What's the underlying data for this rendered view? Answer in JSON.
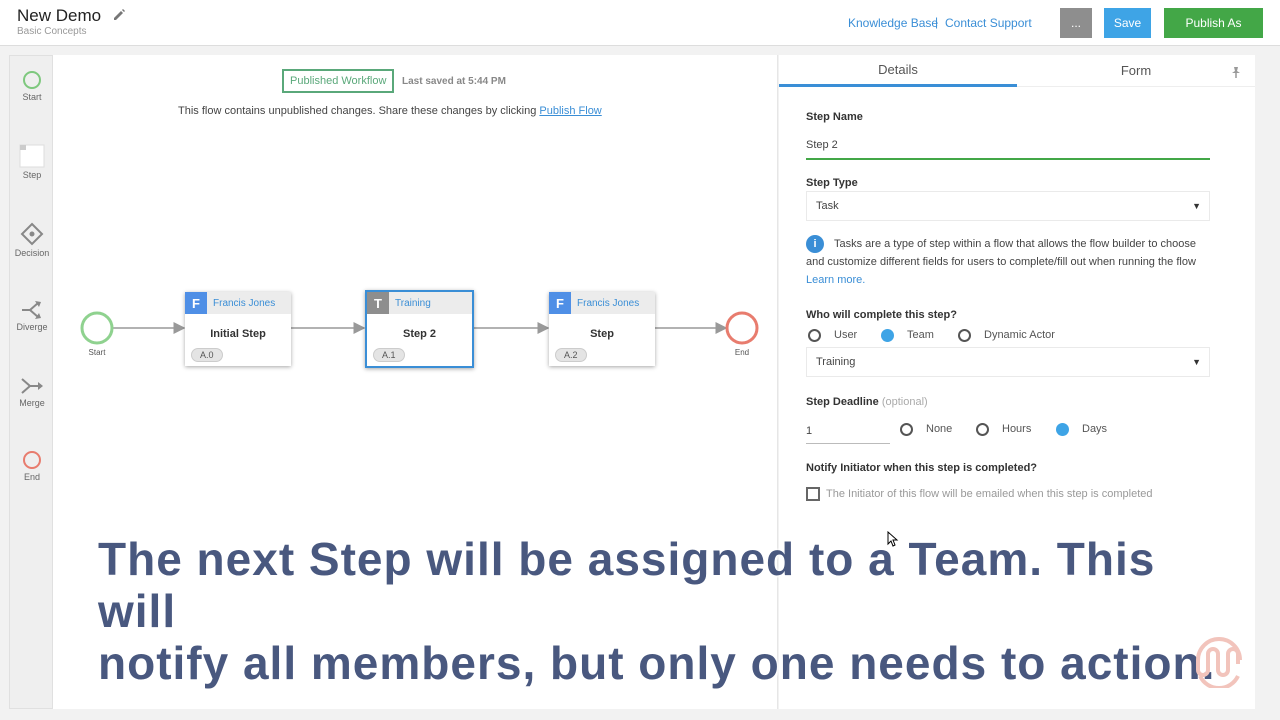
{
  "header": {
    "title": "New Demo",
    "subtitle": "Basic Concepts",
    "knowledge_base": "Knowledge Base",
    "separator": "|",
    "contact_support": "Contact Support",
    "more_label": "...",
    "save_label": "Save",
    "publish_label": "Publish As"
  },
  "toolbar": {
    "items": [
      {
        "label": "Start",
        "icon": "start-circle-icon",
        "color": "#7ec87e"
      },
      {
        "label": "Step",
        "icon": "step-box-icon"
      },
      {
        "label": "Decision",
        "icon": "decision-diamond-icon"
      },
      {
        "label": "Diverge",
        "icon": "diverge-arrows-icon"
      },
      {
        "label": "Merge",
        "icon": "merge-arrows-icon"
      },
      {
        "label": "End",
        "icon": "end-circle-icon",
        "color": "#e87c6e"
      }
    ]
  },
  "canvas": {
    "published_badge": "Published Workflow",
    "last_saved": "Last saved at 5:44 PM",
    "unpublished_message": "This flow contains unpublished changes. Share these changes by clicking",
    "publish_flow_link": "Publish Flow",
    "start_label": "Start",
    "end_label": "End",
    "steps": [
      {
        "letter": "F",
        "actor": "Francis Jones",
        "name": "Initial Step",
        "code": "A.0",
        "color": "#4f8fe6",
        "selected": false
      },
      {
        "letter": "T",
        "actor": "Training",
        "name": "Step 2",
        "code": "A.1",
        "color": "#8e8e8e",
        "selected": true
      },
      {
        "letter": "F",
        "actor": "Francis Jones",
        "name": "Step",
        "code": "A.2",
        "color": "#4f8fe6",
        "selected": false
      }
    ]
  },
  "panel": {
    "tab_details": "Details",
    "tab_form": "Form",
    "step_name_label": "Step Name",
    "step_name_value": "Step 2",
    "step_type_label": "Step Type",
    "step_type_value": "Task",
    "info_text": "Tasks are a type of step within a flow that allows the flow builder to choose and customize different fields for users to complete/fill out when running the flow",
    "learn_more": "Learn more.",
    "who_label": "Who will complete this step?",
    "who_options": [
      "User",
      "Team",
      "Dynamic Actor"
    ],
    "who_selected": "Team",
    "team_value": "Training",
    "deadline_label": "Step Deadline",
    "deadline_optional": "(optional)",
    "deadline_value": "1",
    "deadline_options": [
      "None",
      "Hours",
      "Days"
    ],
    "deadline_selected": "Days",
    "notify_label": "Notify Initiator when this step is completed?",
    "notify_text": "The Initiator of this flow will be emailed when this step is completed",
    "notify_checked": false
  },
  "caption": {
    "line1": "The next Step will be assigned to a Team. This will",
    "line2": "notify all members, but only one needs to action."
  },
  "colors": {
    "accent": "#3a8ed6",
    "save": "#3ea4e6",
    "publish": "#43a747",
    "start": "#7ec87e",
    "end": "#e87c6e"
  }
}
